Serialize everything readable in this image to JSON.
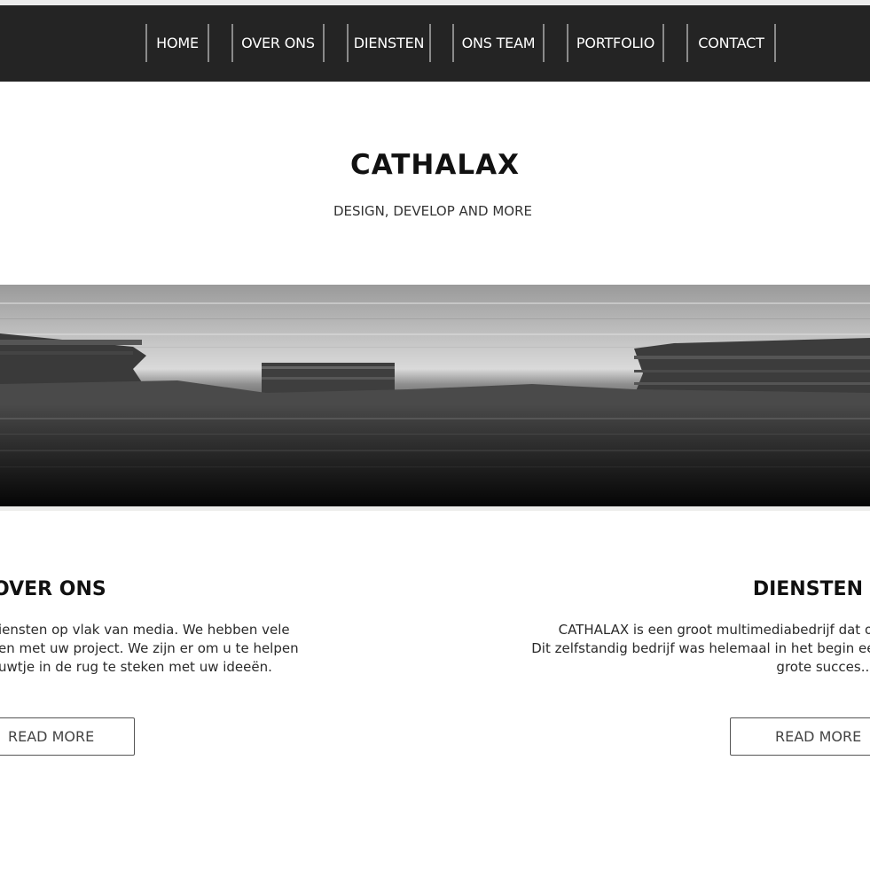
{
  "nav": {
    "items": [
      {
        "label": "HOME"
      },
      {
        "label": "OVER ONS"
      },
      {
        "label": "DIENSTEN"
      },
      {
        "label": "ONS TEAM"
      },
      {
        "label": "PORTFOLIO"
      },
      {
        "label": "CONTACT"
      }
    ]
  },
  "hero": {
    "title": "CATHALAX",
    "subtitle": "DESIGN, DEVELOP AND MORE"
  },
  "sections": {
    "over_ons": {
      "title": "OVER ONS",
      "lines": [
        "iensten op vlak van media. We hebben vele",
        "en met uw project. We zijn er om u te helpen",
        "uwtje in de rug te steken met uw ideeën."
      ],
      "button": "READ MORE"
    },
    "diensten": {
      "title": "DIENSTEN",
      "lines": [
        "CATHALAX is een groot multimediabedrijf dat oorspr",
        "Dit zelfstandig bedrijf was helemaal in het begin een \"or",
        "grote succes..."
      ],
      "button": "READ MORE"
    }
  },
  "colors": {
    "nav_bg": "#242424",
    "nav_divider": "#8a8a8a",
    "text_dark": "#111111"
  }
}
